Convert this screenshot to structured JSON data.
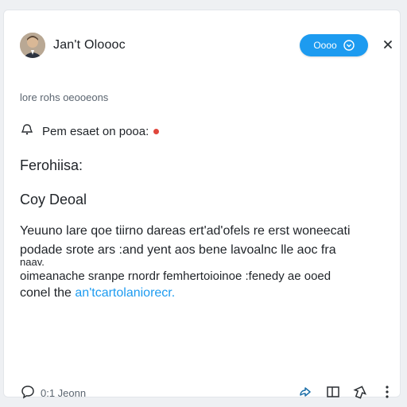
{
  "post": {
    "author": "Jan't Oloooc",
    "follow_label": "Oooo",
    "meta": "lore rohs oeooeons",
    "reminder": "Pem esaet on pooa:",
    "section_heading": "Ferohiisa:",
    "title": "Coy Deoal",
    "body": {
      "line1": "Yeuuno lare qoe tiirno dareas ert'ad'ofels re erst woneecati",
      "line2": "podade srote ars :and yent aos bene lavoalnc lle aoc fra",
      "line2b": "naav.",
      "line3": "oimeanache sranpe rnordr femhertoioinoe :fenedy ae ooed",
      "line4_prefix": "conel the ",
      "line4_link": "an'tcartolaniorecr."
    },
    "footer": {
      "replies": "0:1 Jeonn"
    }
  },
  "colors": {
    "accent": "#1d9bf0",
    "alert_dot": "#e0473c"
  },
  "icons": {
    "follow": "chevron-down-icon",
    "close": "close-icon",
    "reminder": "bell-icon",
    "replies": "comment-icon",
    "actions": [
      "share-icon",
      "bookmark-icon",
      "like-icon",
      "more-icon"
    ]
  }
}
